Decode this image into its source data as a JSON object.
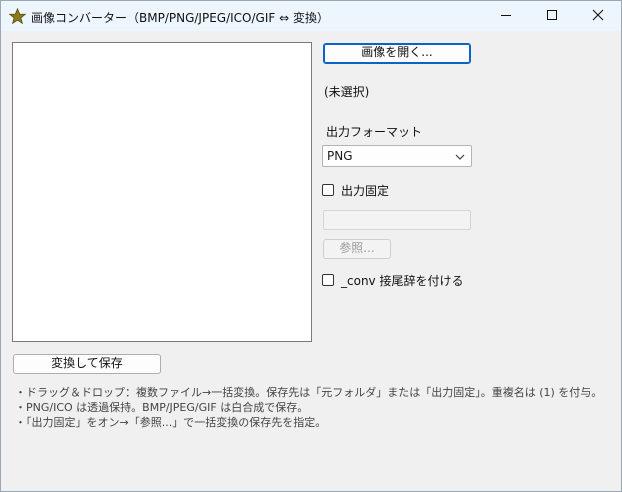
{
  "window": {
    "title": "画像コンバーター（BMP/PNG/JPEG/ICO/GIF ⇔ 変換）",
    "icon": "star-icon",
    "controls": {
      "minimize": "minimize-icon",
      "maximize": "maximize-icon",
      "close": "close-icon"
    }
  },
  "right_panel": {
    "open_button": "画像を開く...",
    "selected_file": "(未選択)",
    "format_label": "出力フォーマット",
    "format_selected": "PNG",
    "fixed_output_label": "出力固定",
    "fixed_output_checked": false,
    "output_path_value": "",
    "browse_button": "参照...",
    "conv_suffix_label": "_conv 接尾辞を付ける",
    "conv_suffix_checked": false
  },
  "bottom": {
    "convert_button": "変換して保存",
    "notes": [
      "・ドラッグ＆ドロップ：複数ファイル→一括変換。保存先は「元フォルダ」または「出力固定」。重複名は (1) を付与。",
      "・PNG/ICO は透過保持。BMP/JPEG/GIF は白合成で保存。",
      "・「出力固定」をオン→「参照...」で一括変換の保存先を指定。"
    ]
  },
  "colors": {
    "titlebar": "#eef6fd",
    "window_bg": "#f0f0f0",
    "accent_border": "#0a64c8",
    "star_fill": "#8a7a1e"
  }
}
